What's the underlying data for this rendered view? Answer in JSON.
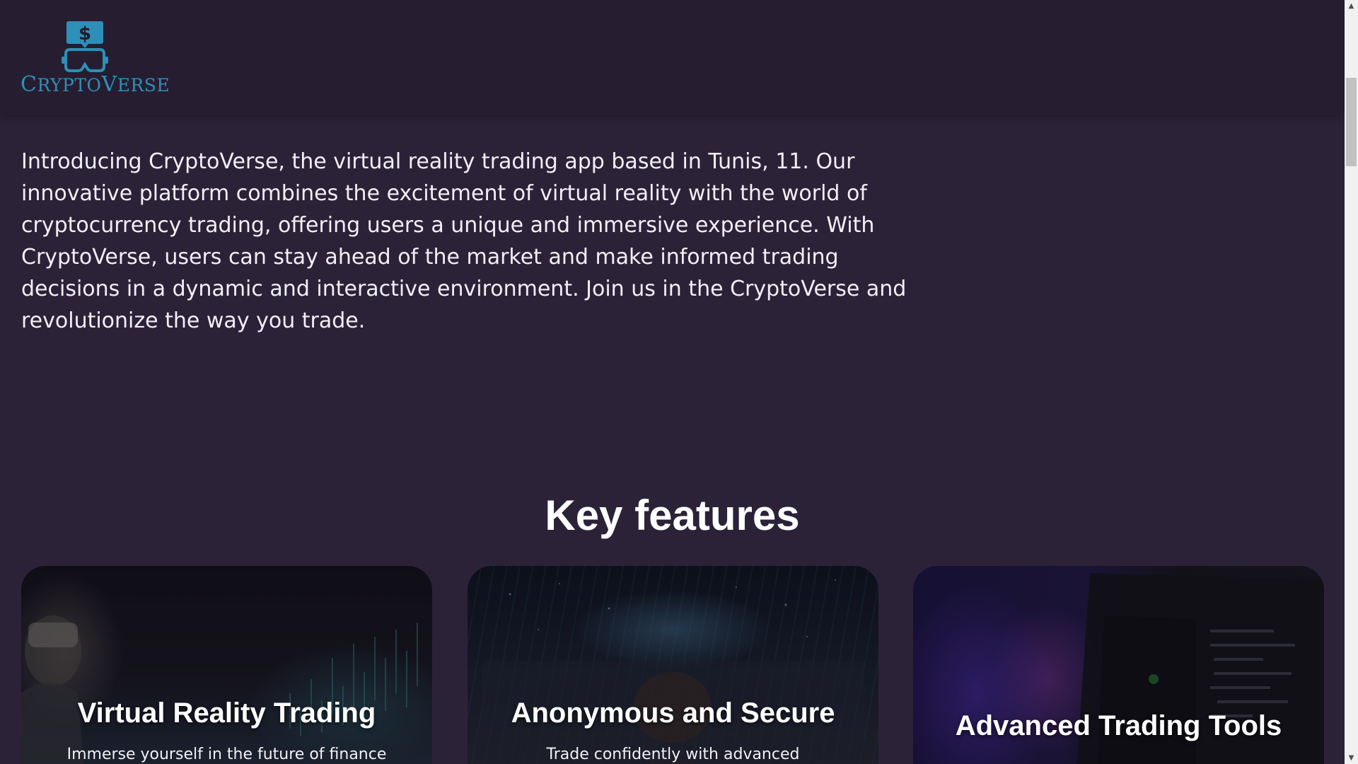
{
  "header": {
    "logo": {
      "brand_first_letter": "C",
      "brand_mid": "RYPTO",
      "brand_second_letter": "V",
      "brand_rest": "ERSE",
      "icon": "dollar-vr-headset-icon",
      "color": "#2e8fb8"
    }
  },
  "intro": {
    "text": "Introducing CryptoVerse, the virtual reality trading app based in Tunis, 11. Our innovative platform combines the excitement of virtual reality with the world of cryptocurrency trading, offering users a unique and immersive experience. With CryptoVerse, users can stay ahead of the market and make informed trading decisions in a dynamic and interactive environment. Join us in the CryptoVerse and revolutionize the way you trade."
  },
  "features": {
    "title": "Key features",
    "cards": [
      {
        "title": "Virtual Reality Trading",
        "description": "Immerse yourself in the future of finance"
      },
      {
        "title": "Anonymous and Secure",
        "description": "Trade confidently with advanced"
      },
      {
        "title": "Advanced Trading Tools",
        "description": ""
      }
    ]
  },
  "scrollbar": {
    "up_arrow": "▲",
    "down_arrow": "▼"
  },
  "colors": {
    "page_background": "#2c2238",
    "header_background": "#261d31",
    "accent": "#2e8fb8"
  }
}
